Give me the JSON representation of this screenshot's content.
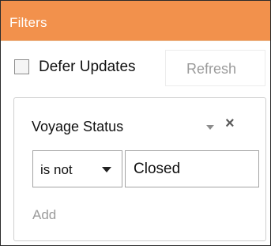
{
  "panel": {
    "title": "Filters"
  },
  "toolbar": {
    "defer_updates_label": "Defer Updates",
    "defer_updates_checked": false,
    "refresh_label": "Refresh"
  },
  "filter": {
    "field_label": "Voyage Status",
    "operator_value": "is not",
    "value": "Closed",
    "add_label": "Add"
  },
  "icons": {
    "field_menu": "chevron-down-icon",
    "remove_filter": "close-icon",
    "operator_dropdown": "chevron-down-icon"
  },
  "colors": {
    "header_background": "#f2914c",
    "header_text": "#ffffff",
    "disabled_text": "#9b9b9b"
  }
}
